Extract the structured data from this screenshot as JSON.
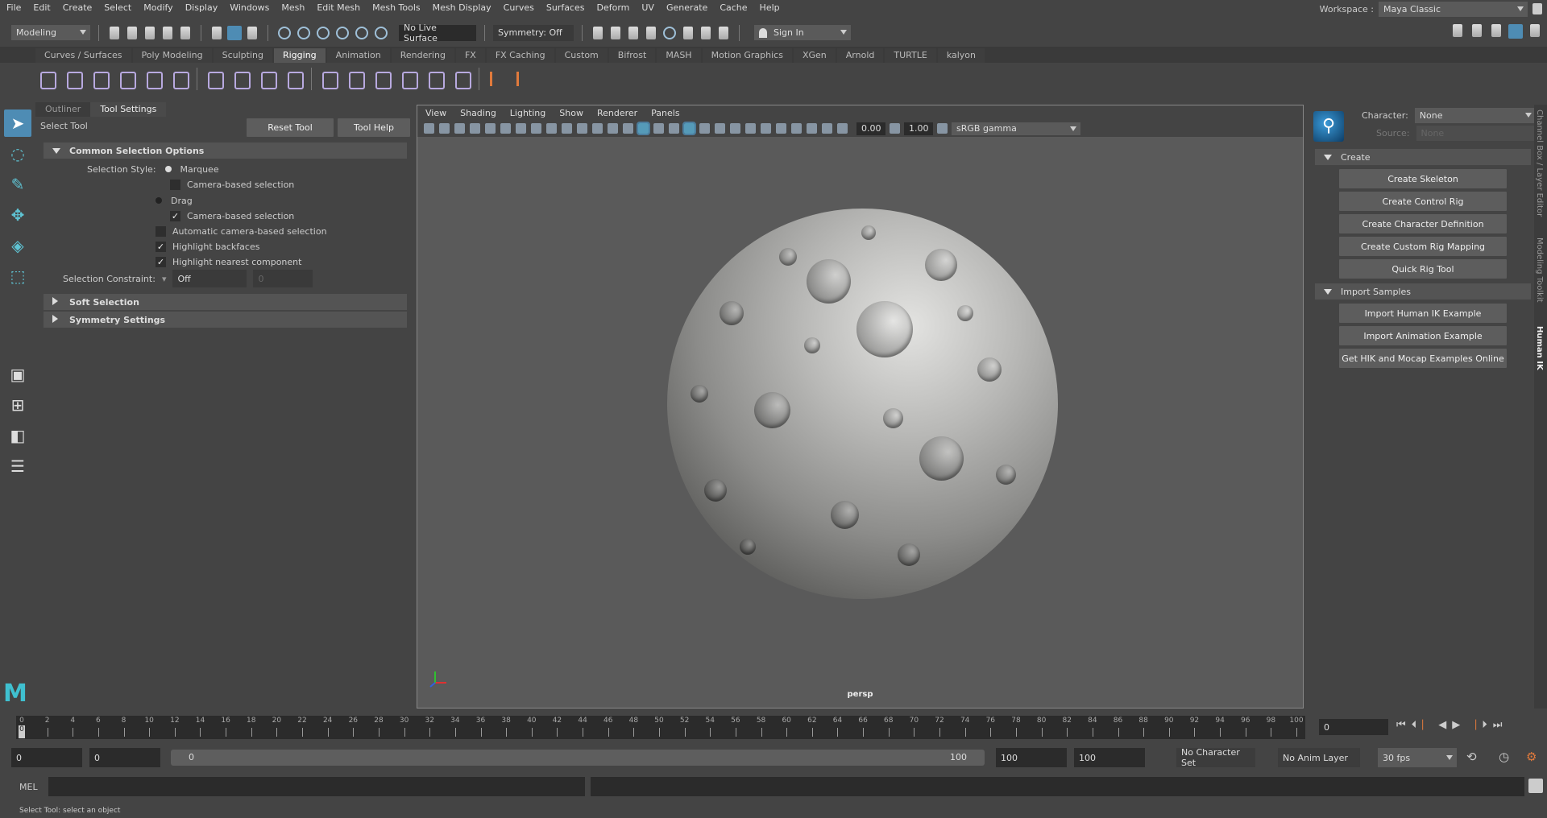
{
  "menubar": [
    "File",
    "Edit",
    "Create",
    "Select",
    "Modify",
    "Display",
    "Windows",
    "Mesh",
    "Edit Mesh",
    "Mesh Tools",
    "Mesh Display",
    "Curves",
    "Surfaces",
    "Deform",
    "UV",
    "Generate",
    "Cache",
    "Help"
  ],
  "workspace": {
    "label": "Workspace :",
    "value": "Maya Classic"
  },
  "statusline": {
    "menuset": "Modeling",
    "live_surface": "No Live Surface",
    "symmetry": "Symmetry: Off",
    "sign_in": "Sign In"
  },
  "shelf": {
    "tabs": [
      "Curves / Surfaces",
      "Poly Modeling",
      "Sculpting",
      "Rigging",
      "Animation",
      "Rendering",
      "FX",
      "FX Caching",
      "Custom",
      "Bifrost",
      "MASH",
      "Motion Graphics",
      "XGen",
      "Arnold",
      "TURTLE",
      "kalyon"
    ],
    "active": "Rigging",
    "icons": [
      "joint-tool-icon",
      "ik-handle-icon",
      "ik-spline-icon",
      "insert-joint-icon",
      "humanik-icon",
      "quick-rig-icon",
      "sep",
      "bind-skin-icon",
      "smooth-bind-icon",
      "lattice-icon",
      "cluster-icon",
      "sep",
      "parent-constraint-icon",
      "point-constraint-icon",
      "orient-constraint-icon",
      "scale-constraint-icon",
      "aim-constraint-icon",
      "pole-vector-icon",
      "sep",
      "add-influence-icon",
      "remove-influence-icon"
    ]
  },
  "panel": {
    "tabs": [
      "Outliner",
      "Tool Settings"
    ],
    "tool_name": "Select Tool",
    "reset": "Reset Tool",
    "help": "Tool Help",
    "common": "Common Selection Options",
    "style_label": "Selection Style:",
    "marquee": "Marquee",
    "camera_based": "Camera-based selection",
    "drag": "Drag",
    "auto_camera": "Automatic camera-based selection",
    "backfaces": "Highlight backfaces",
    "nearest": "Highlight nearest component",
    "constraint_label": "Selection Constraint:",
    "constraint_value": "Off",
    "constraint_num": "0",
    "soft": "Soft Selection",
    "symmetry": "Symmetry Settings"
  },
  "viewport": {
    "menus": [
      "View",
      "Shading",
      "Lighting",
      "Show",
      "Renderer",
      "Panels"
    ],
    "exposure": "0.00",
    "gamma": "1.00",
    "colorspace": "sRGB gamma",
    "camera": "persp"
  },
  "hik": {
    "character_label": "Character:",
    "character": "None",
    "source_label": "Source:",
    "source": "None",
    "create": "Create",
    "create_buttons": [
      "Create Skeleton",
      "Create Control Rig",
      "Create Character Definition",
      "Create Custom Rig Mapping",
      "Quick Rig Tool"
    ],
    "import": "Import Samples",
    "import_buttons": [
      "Import Human IK Example",
      "Import Animation Example",
      "Get HIK and Mocap Examples Online"
    ]
  },
  "side_tabs": [
    "Channel Box / Layer Editor",
    "Modeling Toolkit",
    "Human IK"
  ],
  "time": {
    "current": "0",
    "frame_field": "0",
    "start": "0",
    "anim_start": "0",
    "range_start": "0",
    "range_end": "100",
    "anim_end": "100",
    "end": "100",
    "char_set": "No Character Set",
    "anim_layer": "No Anim Layer",
    "fps": "30 fps"
  },
  "cmd": {
    "lang": "MEL"
  },
  "helpline": "Select Tool: select an object"
}
